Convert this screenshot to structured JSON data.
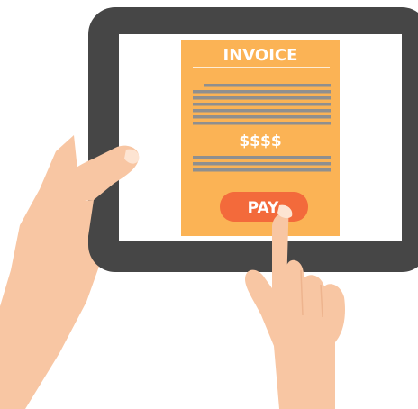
{
  "invoice": {
    "title": "INVOICE",
    "amount": "$$$$",
    "pay_label": "PAY"
  },
  "colors": {
    "tablet_frame": "#464646",
    "screen": "#ffffff",
    "invoice_paper": "#fbb355",
    "invoice_lines": "#8f8f8f",
    "pay_button": "#f36a3b",
    "skin": "#f8c6a3",
    "skin_shadow": "#eeb48e"
  }
}
